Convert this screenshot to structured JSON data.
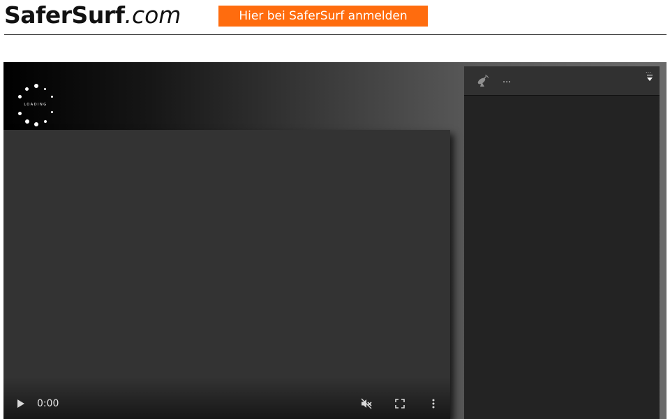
{
  "header": {
    "logo_brand": "SaferSurf",
    "logo_tld": ".com",
    "signup_label": "Hier bei SaferSurf anmelden"
  },
  "loader": {
    "label": "LOADING"
  },
  "video": {
    "time": "0:00",
    "icons": [
      "play-icon",
      "muted-icon",
      "fullscreen-icon",
      "more-options-icon"
    ]
  },
  "panel": {
    "title": "...",
    "more": "...",
    "icons": [
      "satellite-icon",
      "dropdown-caret-icon"
    ]
  },
  "colors": {
    "signup_bg": "#ff6c0e",
    "video_bg": "#333333",
    "panel_bg": "#232323",
    "panel_header_bg": "#313131"
  }
}
